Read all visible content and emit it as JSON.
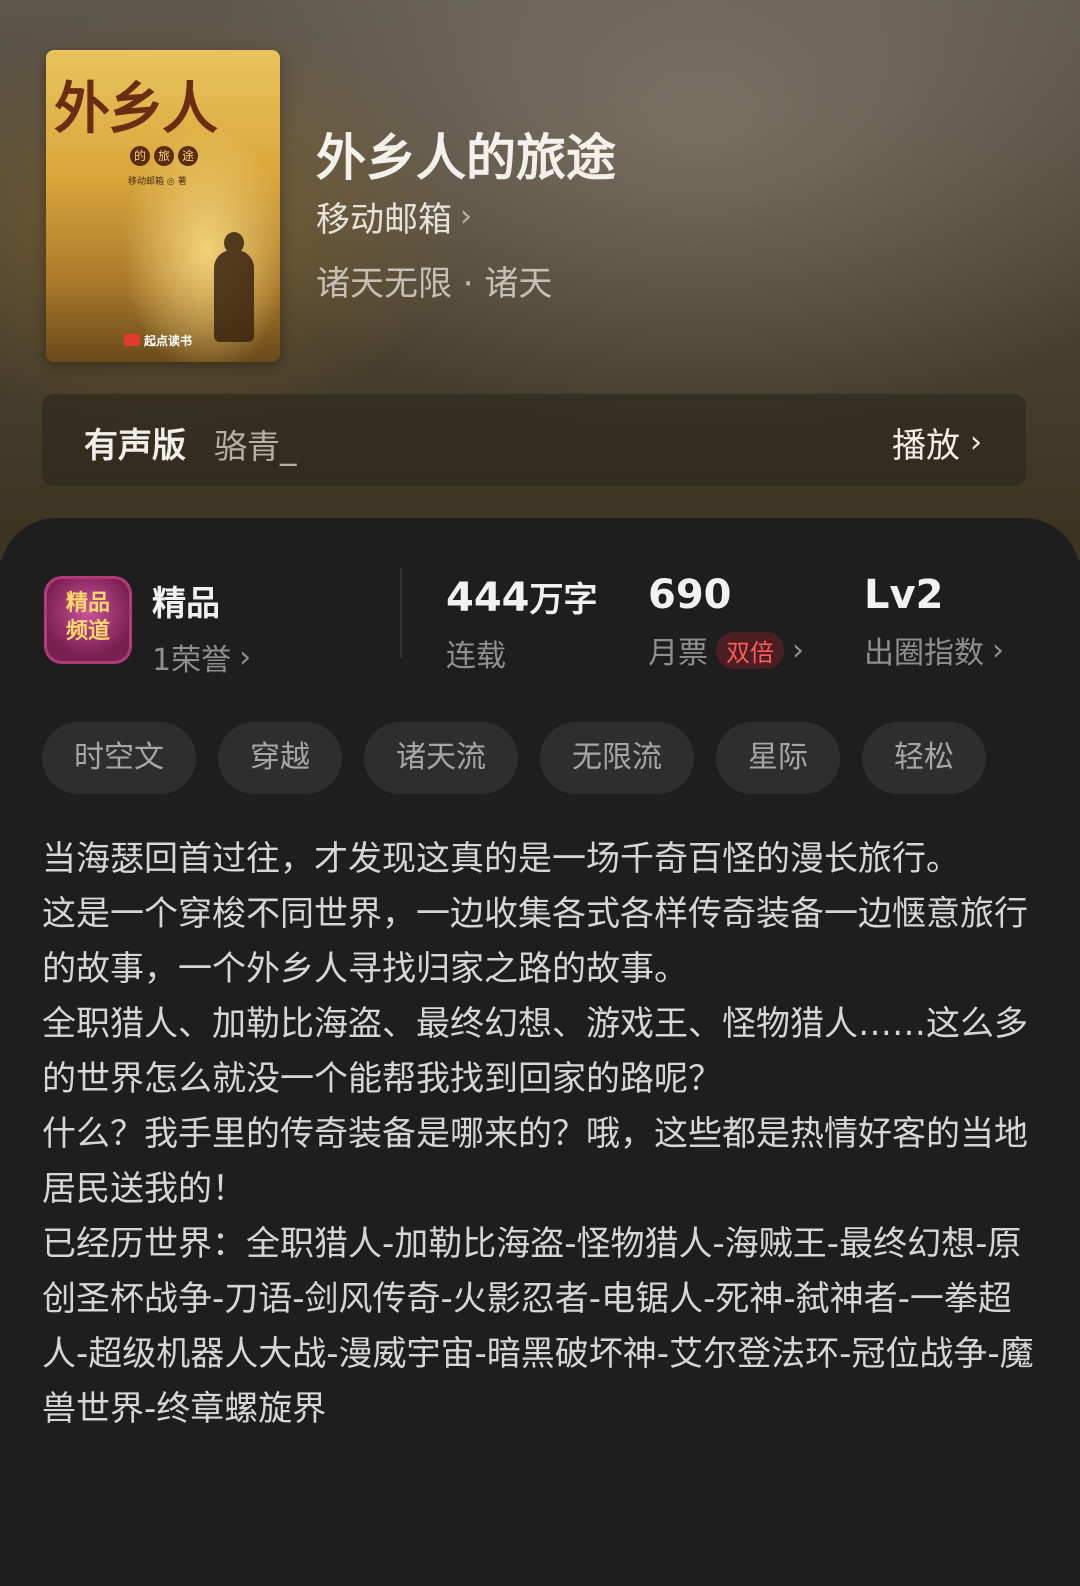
{
  "cover": {
    "title": "外乡人",
    "subtitle_chars": [
      "的",
      "旅",
      "途"
    ],
    "author_line": "移动邮箱 ◎ 著",
    "publisher": "起点读书"
  },
  "book": {
    "title": "外乡人的旅途",
    "author": "移动邮箱",
    "genre": "诸天无限 · 诸天"
  },
  "audio": {
    "label": "有声版",
    "narrator": "骆青_",
    "play_label": "播放"
  },
  "badge": {
    "emblem_text": "精品频道",
    "title": "精品",
    "honor": "1荣誉"
  },
  "stats": {
    "words_value": "444",
    "words_unit": "万字",
    "words_status": "连载",
    "monthly_votes": "690",
    "monthly_votes_label": "月票",
    "double_tag": "双倍",
    "level": "Lv2",
    "level_label": "出圈指数"
  },
  "tags": [
    "时空文",
    "穿越",
    "诸天流",
    "无限流",
    "星际",
    "轻松"
  ],
  "description": [
    "当海瑟回首过往，才发现这真的是一场千奇百怪的漫长旅行。",
    "这是一个穿梭不同世界，一边收集各式各样传奇装备一边惬意旅行的故事，一个外乡人寻找归家之路的故事。",
    "全职猎人、加勒比海盗、最终幻想、游戏王、怪物猎人……这么多的世界怎么就没一个能帮我找到回家的路呢？",
    "什么？我手里的传奇装备是哪来的？哦，这些都是热情好客的当地居民送我的！",
    "已经历世界：全职猎人-加勒比海盗-怪物猎人-海贼王-最终幻想-原创圣杯战争-刀语-剑风传奇-火影忍者-电锯人-死神-弑神者-一拳超人-超级机器人大战-漫威宇宙-暗黑破坏神-艾尔登法环-冠位战争-魔兽世界-终章螺旋界"
  ]
}
